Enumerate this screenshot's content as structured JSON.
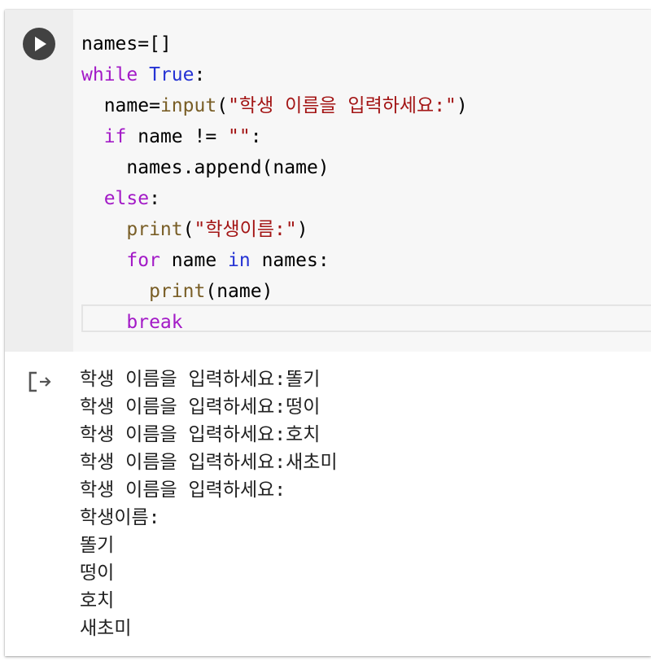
{
  "cell": {
    "run_button_icon": "play-icon",
    "output_icon": "output-arrow-icon",
    "code_lines": [
      {
        "indent": "",
        "tokens": [
          {
            "t": "names=[]",
            "c": "plain"
          }
        ]
      },
      {
        "indent": "",
        "tokens": [
          {
            "t": "while",
            "c": "kw"
          },
          {
            "t": " ",
            "c": "plain"
          },
          {
            "t": "True",
            "c": "kw-blue"
          },
          {
            "t": ":",
            "c": "plain"
          }
        ]
      },
      {
        "indent": "  ",
        "tokens": [
          {
            "t": "name=",
            "c": "plain"
          },
          {
            "t": "input",
            "c": "fn"
          },
          {
            "t": "(",
            "c": "plain"
          },
          {
            "t": "\"학생 이름을 입력하세요:\"",
            "c": "str"
          },
          {
            "t": ")",
            "c": "plain"
          }
        ]
      },
      {
        "indent": "  ",
        "tokens": [
          {
            "t": "if",
            "c": "kw"
          },
          {
            "t": " name != ",
            "c": "plain"
          },
          {
            "t": "\"\"",
            "c": "str"
          },
          {
            "t": ":",
            "c": "plain"
          }
        ]
      },
      {
        "indent": "    ",
        "tokens": [
          {
            "t": "names.append(name)",
            "c": "plain"
          }
        ]
      },
      {
        "indent": "  ",
        "tokens": [
          {
            "t": "else",
            "c": "kw"
          },
          {
            "t": ":",
            "c": "plain"
          }
        ]
      },
      {
        "indent": "    ",
        "tokens": [
          {
            "t": "print",
            "c": "fn"
          },
          {
            "t": "(",
            "c": "plain"
          },
          {
            "t": "\"학생이름:\"",
            "c": "str"
          },
          {
            "t": ")",
            "c": "plain"
          }
        ]
      },
      {
        "indent": "    ",
        "tokens": [
          {
            "t": "for",
            "c": "kw"
          },
          {
            "t": " name ",
            "c": "plain"
          },
          {
            "t": "in",
            "c": "kw-blue"
          },
          {
            "t": " names:",
            "c": "plain"
          }
        ]
      },
      {
        "indent": "      ",
        "tokens": [
          {
            "t": "print",
            "c": "fn"
          },
          {
            "t": "(name)",
            "c": "plain"
          }
        ]
      },
      {
        "indent": "    ",
        "tokens": [
          {
            "t": "break",
            "c": "kw"
          }
        ]
      }
    ],
    "output_lines": [
      "학생 이름을 입력하세요:똘기",
      "학생 이름을 입력하세요:떵이",
      "학생 이름을 입력하세요:호치",
      "학생 이름을 입력하세요:새초미",
      "학생 이름을 입력하세요:",
      "학생이름:",
      "똘기",
      "떵이",
      "호치",
      "새초미"
    ]
  },
  "colors": {
    "keyword": "#a31ac7",
    "builtin_constant": "#2533d4",
    "function": "#795e26",
    "string": "#a31515",
    "gutter": "#eeeeee",
    "code_background": "#f7f7f7",
    "run_button": "#424242"
  }
}
